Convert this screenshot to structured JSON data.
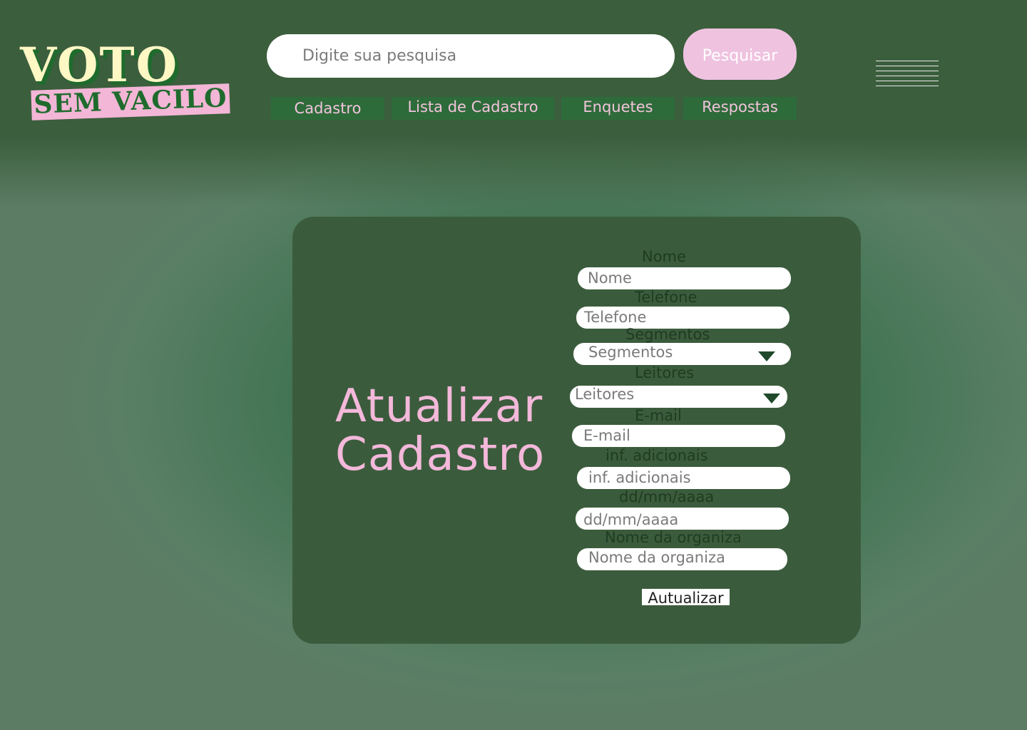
{
  "logo": {
    "line1": "VOTO",
    "line2": "SEM VACILO"
  },
  "search": {
    "placeholder": "Digite sua pesquisa",
    "button_label": "Pesquisar"
  },
  "nav": {
    "items": [
      "Cadastro",
      "Lista de Cadastro",
      "Enquetes",
      "Respostas"
    ]
  },
  "icons": {
    "menu": "hamburger-menu-icon",
    "dropdown": "caret-down-icon"
  },
  "colors": {
    "accent_pink": "#f3b8da",
    "dark_green": "#3b5c3c",
    "nav_green": "#2e6b3a"
  },
  "form": {
    "title_line1": "Atualizar",
    "title_line2": "Cadastro",
    "fields": [
      {
        "label": "Nome",
        "placeholder": "Nome"
      },
      {
        "label": "Telefone",
        "placeholder": "Telefone"
      },
      {
        "label": "Segmentos",
        "placeholder": "Segmentos"
      },
      {
        "label": "Leitores",
        "placeholder": "Leitores"
      },
      {
        "label": "E-mail",
        "placeholder": "E-mail"
      },
      {
        "label": "inf. adicionais",
        "placeholder": "inf. adicionais"
      },
      {
        "label": "dd/mm/aaaa",
        "placeholder": "dd/mm/aaaa"
      },
      {
        "label": "Nome da organiza",
        "placeholder": "Nome da organiza"
      }
    ],
    "submit_label": "Autualizar"
  }
}
